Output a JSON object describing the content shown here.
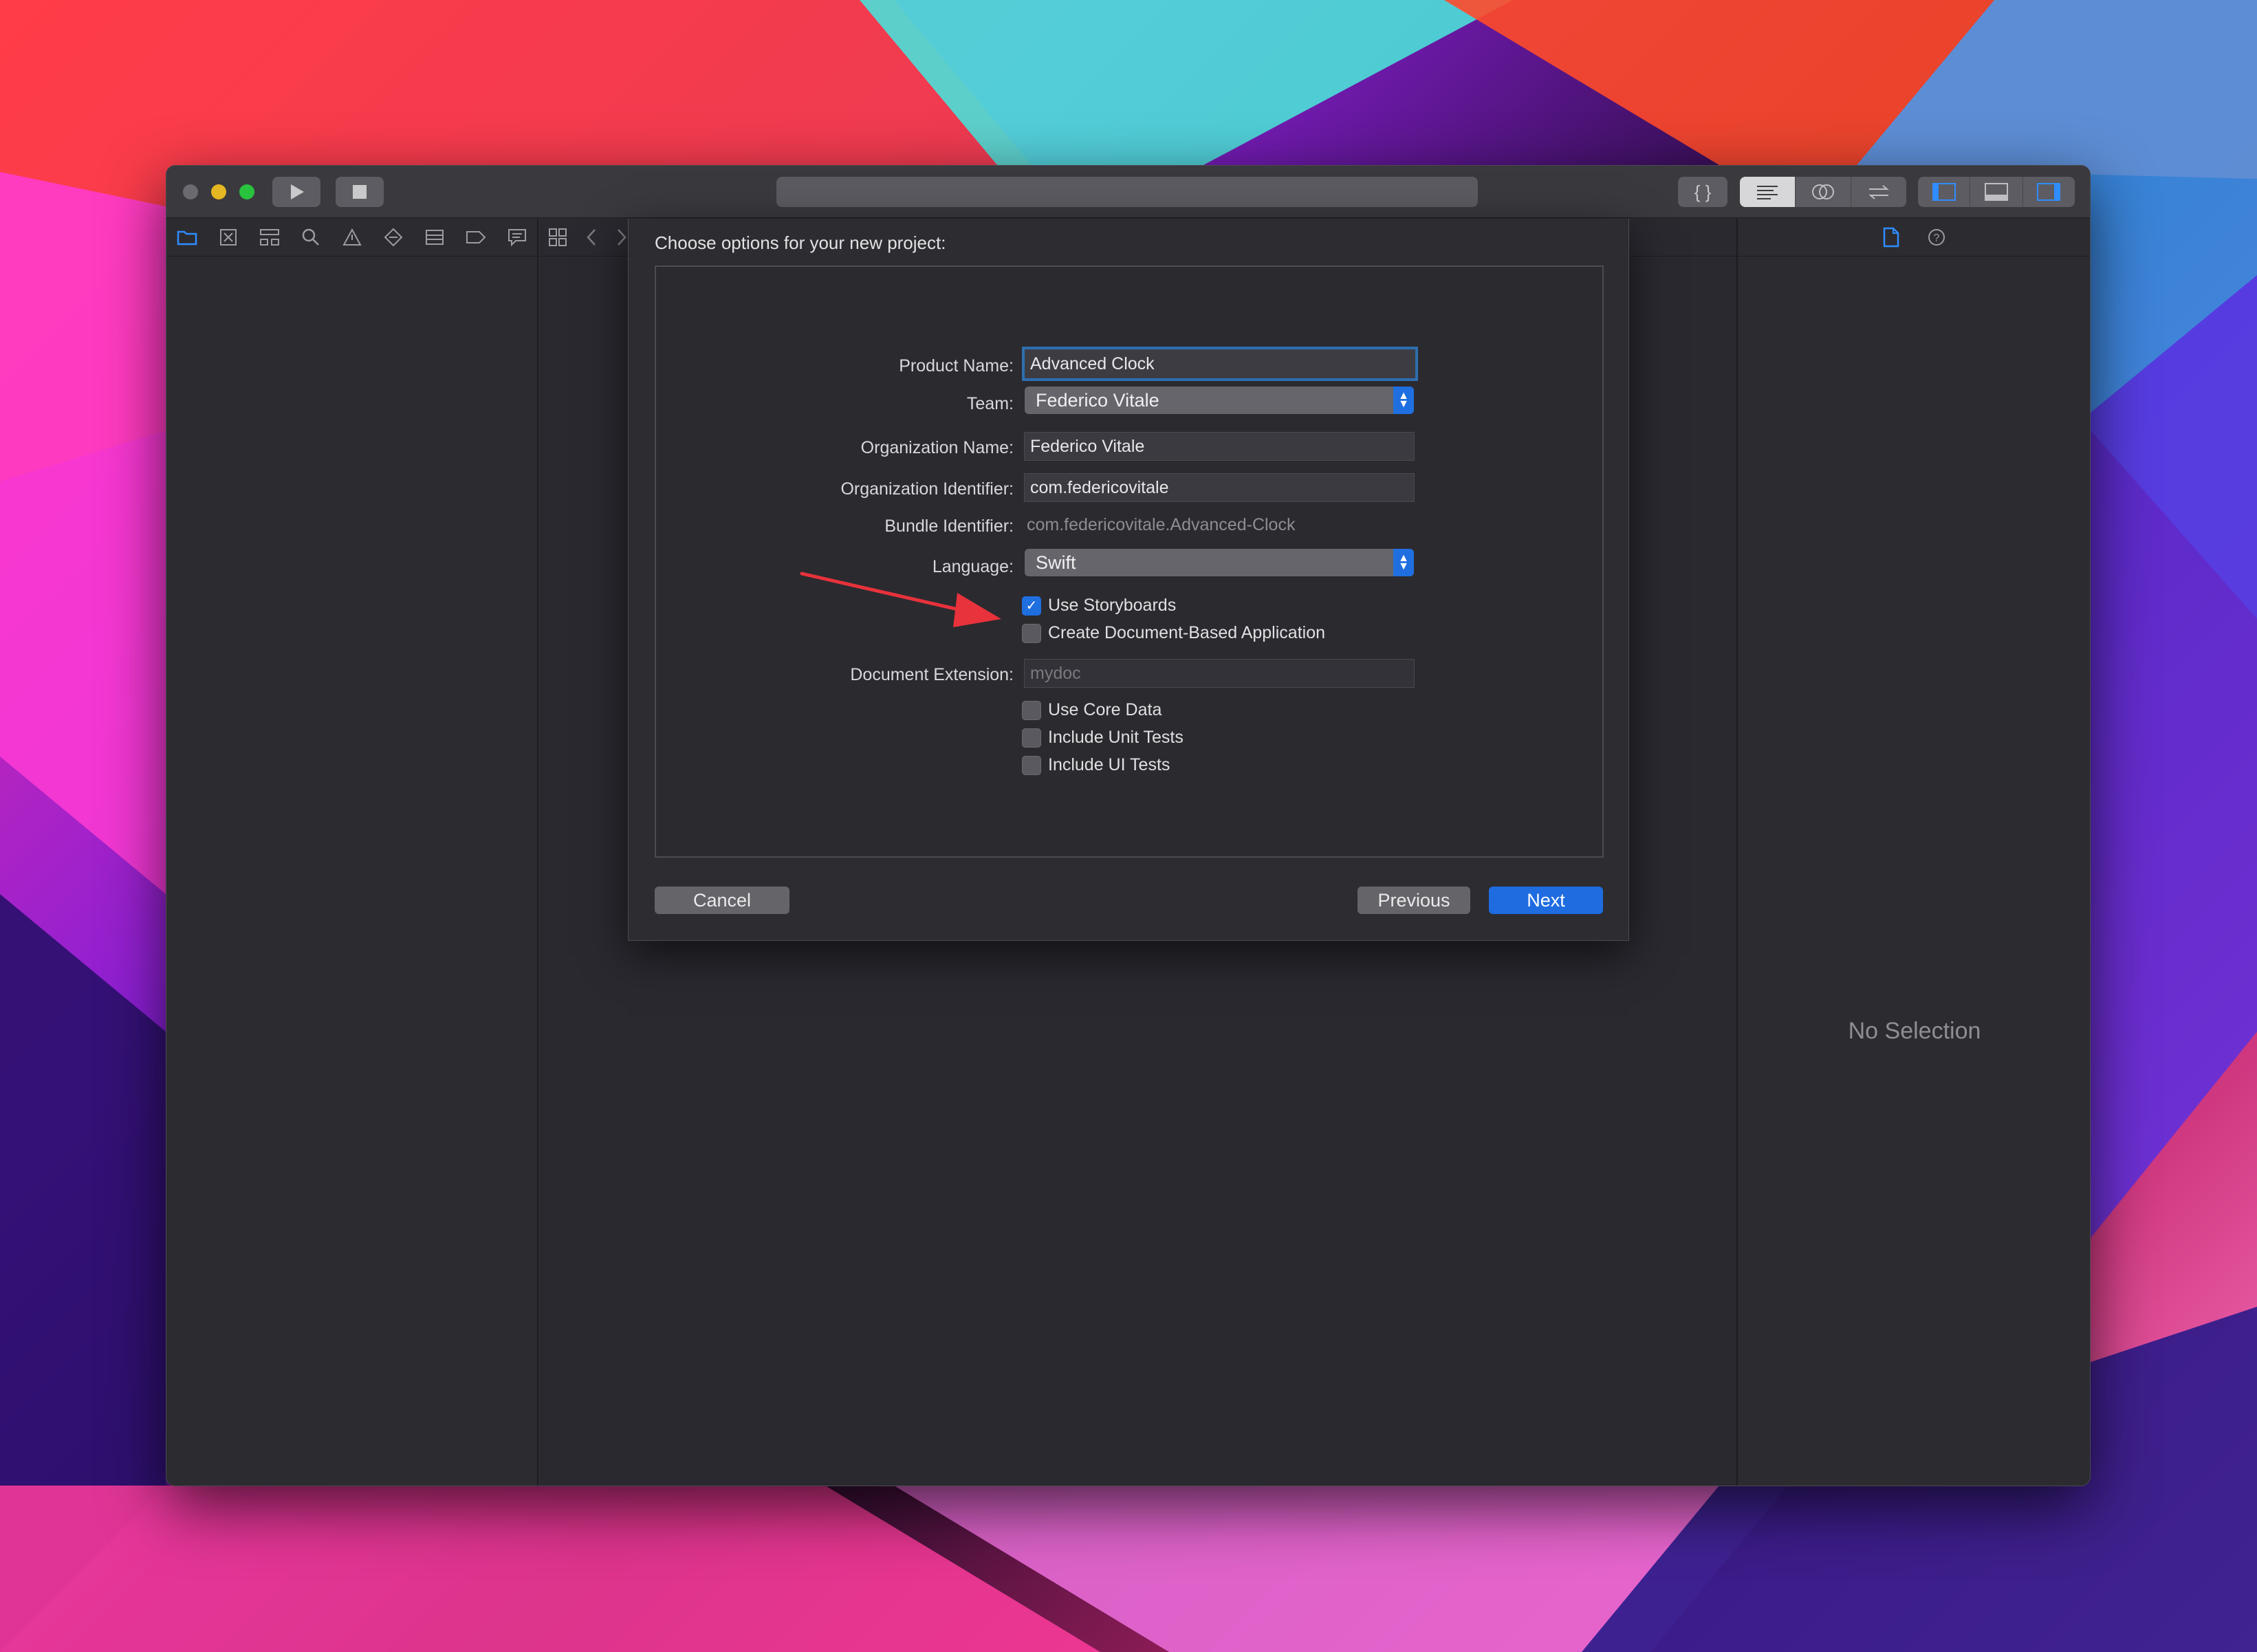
{
  "colors": {
    "accent": "#1f6fe0",
    "window_bg": "#2c2b30",
    "arrow": "#e8323c"
  },
  "toolbar": {
    "run_icon": "play-icon",
    "stop_icon": "stop-icon",
    "library_label": "{ }",
    "editor_modes": [
      "standard-editor-icon",
      "assistant-editor-icon",
      "version-editor-icon"
    ],
    "panel_toggles": [
      "navigator-toggle-icon",
      "debug-area-toggle-icon",
      "inspector-toggle-icon"
    ]
  },
  "navigator": {
    "icons": [
      "folder-icon",
      "source-control-icon",
      "hierarchy-icon",
      "search-icon",
      "warning-icon",
      "test-icon",
      "debug-icon",
      "breakpoint-icon",
      "report-icon"
    ]
  },
  "editor": {
    "jump_icons": [
      "grid-icon",
      "back-icon",
      "forward-icon"
    ]
  },
  "inspector": {
    "icons": [
      "file-inspector-icon",
      "help-icon"
    ],
    "empty_label": "No Selection"
  },
  "sheet": {
    "title": "Choose options for your new project:",
    "fields": {
      "product_name": {
        "label": "Product Name:",
        "value": "Advanced Clock"
      },
      "team": {
        "label": "Team:",
        "value": "Federico Vitale"
      },
      "org_name": {
        "label": "Organization Name:",
        "value": "Federico Vitale"
      },
      "org_id": {
        "label": "Organization Identifier:",
        "value": "com.federicovitale"
      },
      "bundle_id": {
        "label": "Bundle Identifier:",
        "value": "com.federicovitale.Advanced-Clock"
      },
      "language": {
        "label": "Language:",
        "value": "Swift"
      },
      "doc_ext": {
        "label": "Document Extension:",
        "placeholder": "mydoc"
      }
    },
    "checkboxes": {
      "storyboards": {
        "label": "Use Storyboards",
        "checked": true
      },
      "document_based": {
        "label": "Create Document-Based Application",
        "checked": false
      },
      "core_data": {
        "label": "Use Core Data",
        "checked": false
      },
      "unit_tests": {
        "label": "Include Unit Tests",
        "checked": false
      },
      "ui_tests": {
        "label": "Include UI Tests",
        "checked": false
      }
    },
    "buttons": {
      "cancel": "Cancel",
      "previous": "Previous",
      "next": "Next"
    }
  }
}
